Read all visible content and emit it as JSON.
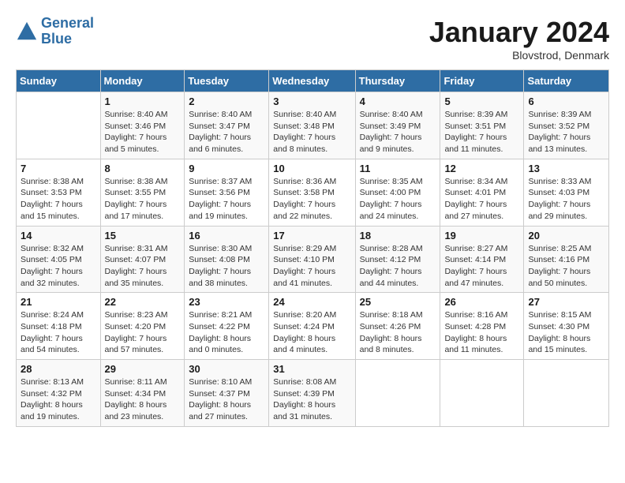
{
  "header": {
    "logo_line1": "General",
    "logo_line2": "Blue",
    "month_title": "January 2024",
    "location": "Blovstrod, Denmark"
  },
  "days_of_week": [
    "Sunday",
    "Monday",
    "Tuesday",
    "Wednesday",
    "Thursday",
    "Friday",
    "Saturday"
  ],
  "weeks": [
    [
      {
        "day": "",
        "sunrise": "",
        "sunset": "",
        "daylight": ""
      },
      {
        "day": "1",
        "sunrise": "Sunrise: 8:40 AM",
        "sunset": "Sunset: 3:46 PM",
        "daylight": "Daylight: 7 hours and 5 minutes."
      },
      {
        "day": "2",
        "sunrise": "Sunrise: 8:40 AM",
        "sunset": "Sunset: 3:47 PM",
        "daylight": "Daylight: 7 hours and 6 minutes."
      },
      {
        "day": "3",
        "sunrise": "Sunrise: 8:40 AM",
        "sunset": "Sunset: 3:48 PM",
        "daylight": "Daylight: 7 hours and 8 minutes."
      },
      {
        "day": "4",
        "sunrise": "Sunrise: 8:40 AM",
        "sunset": "Sunset: 3:49 PM",
        "daylight": "Daylight: 7 hours and 9 minutes."
      },
      {
        "day": "5",
        "sunrise": "Sunrise: 8:39 AM",
        "sunset": "Sunset: 3:51 PM",
        "daylight": "Daylight: 7 hours and 11 minutes."
      },
      {
        "day": "6",
        "sunrise": "Sunrise: 8:39 AM",
        "sunset": "Sunset: 3:52 PM",
        "daylight": "Daylight: 7 hours and 13 minutes."
      }
    ],
    [
      {
        "day": "7",
        "sunrise": "Sunrise: 8:38 AM",
        "sunset": "Sunset: 3:53 PM",
        "daylight": "Daylight: 7 hours and 15 minutes."
      },
      {
        "day": "8",
        "sunrise": "Sunrise: 8:38 AM",
        "sunset": "Sunset: 3:55 PM",
        "daylight": "Daylight: 7 hours and 17 minutes."
      },
      {
        "day": "9",
        "sunrise": "Sunrise: 8:37 AM",
        "sunset": "Sunset: 3:56 PM",
        "daylight": "Daylight: 7 hours and 19 minutes."
      },
      {
        "day": "10",
        "sunrise": "Sunrise: 8:36 AM",
        "sunset": "Sunset: 3:58 PM",
        "daylight": "Daylight: 7 hours and 22 minutes."
      },
      {
        "day": "11",
        "sunrise": "Sunrise: 8:35 AM",
        "sunset": "Sunset: 4:00 PM",
        "daylight": "Daylight: 7 hours and 24 minutes."
      },
      {
        "day": "12",
        "sunrise": "Sunrise: 8:34 AM",
        "sunset": "Sunset: 4:01 PM",
        "daylight": "Daylight: 7 hours and 27 minutes."
      },
      {
        "day": "13",
        "sunrise": "Sunrise: 8:33 AM",
        "sunset": "Sunset: 4:03 PM",
        "daylight": "Daylight: 7 hours and 29 minutes."
      }
    ],
    [
      {
        "day": "14",
        "sunrise": "Sunrise: 8:32 AM",
        "sunset": "Sunset: 4:05 PM",
        "daylight": "Daylight: 7 hours and 32 minutes."
      },
      {
        "day": "15",
        "sunrise": "Sunrise: 8:31 AM",
        "sunset": "Sunset: 4:07 PM",
        "daylight": "Daylight: 7 hours and 35 minutes."
      },
      {
        "day": "16",
        "sunrise": "Sunrise: 8:30 AM",
        "sunset": "Sunset: 4:08 PM",
        "daylight": "Daylight: 7 hours and 38 minutes."
      },
      {
        "day": "17",
        "sunrise": "Sunrise: 8:29 AM",
        "sunset": "Sunset: 4:10 PM",
        "daylight": "Daylight: 7 hours and 41 minutes."
      },
      {
        "day": "18",
        "sunrise": "Sunrise: 8:28 AM",
        "sunset": "Sunset: 4:12 PM",
        "daylight": "Daylight: 7 hours and 44 minutes."
      },
      {
        "day": "19",
        "sunrise": "Sunrise: 8:27 AM",
        "sunset": "Sunset: 4:14 PM",
        "daylight": "Daylight: 7 hours and 47 minutes."
      },
      {
        "day": "20",
        "sunrise": "Sunrise: 8:25 AM",
        "sunset": "Sunset: 4:16 PM",
        "daylight": "Daylight: 7 hours and 50 minutes."
      }
    ],
    [
      {
        "day": "21",
        "sunrise": "Sunrise: 8:24 AM",
        "sunset": "Sunset: 4:18 PM",
        "daylight": "Daylight: 7 hours and 54 minutes."
      },
      {
        "day": "22",
        "sunrise": "Sunrise: 8:23 AM",
        "sunset": "Sunset: 4:20 PM",
        "daylight": "Daylight: 7 hours and 57 minutes."
      },
      {
        "day": "23",
        "sunrise": "Sunrise: 8:21 AM",
        "sunset": "Sunset: 4:22 PM",
        "daylight": "Daylight: 8 hours and 0 minutes."
      },
      {
        "day": "24",
        "sunrise": "Sunrise: 8:20 AM",
        "sunset": "Sunset: 4:24 PM",
        "daylight": "Daylight: 8 hours and 4 minutes."
      },
      {
        "day": "25",
        "sunrise": "Sunrise: 8:18 AM",
        "sunset": "Sunset: 4:26 PM",
        "daylight": "Daylight: 8 hours and 8 minutes."
      },
      {
        "day": "26",
        "sunrise": "Sunrise: 8:16 AM",
        "sunset": "Sunset: 4:28 PM",
        "daylight": "Daylight: 8 hours and 11 minutes."
      },
      {
        "day": "27",
        "sunrise": "Sunrise: 8:15 AM",
        "sunset": "Sunset: 4:30 PM",
        "daylight": "Daylight: 8 hours and 15 minutes."
      }
    ],
    [
      {
        "day": "28",
        "sunrise": "Sunrise: 8:13 AM",
        "sunset": "Sunset: 4:32 PM",
        "daylight": "Daylight: 8 hours and 19 minutes."
      },
      {
        "day": "29",
        "sunrise": "Sunrise: 8:11 AM",
        "sunset": "Sunset: 4:34 PM",
        "daylight": "Daylight: 8 hours and 23 minutes."
      },
      {
        "day": "30",
        "sunrise": "Sunrise: 8:10 AM",
        "sunset": "Sunset: 4:37 PM",
        "daylight": "Daylight: 8 hours and 27 minutes."
      },
      {
        "day": "31",
        "sunrise": "Sunrise: 8:08 AM",
        "sunset": "Sunset: 4:39 PM",
        "daylight": "Daylight: 8 hours and 31 minutes."
      },
      {
        "day": "",
        "sunrise": "",
        "sunset": "",
        "daylight": ""
      },
      {
        "day": "",
        "sunrise": "",
        "sunset": "",
        "daylight": ""
      },
      {
        "day": "",
        "sunrise": "",
        "sunset": "",
        "daylight": ""
      }
    ]
  ]
}
